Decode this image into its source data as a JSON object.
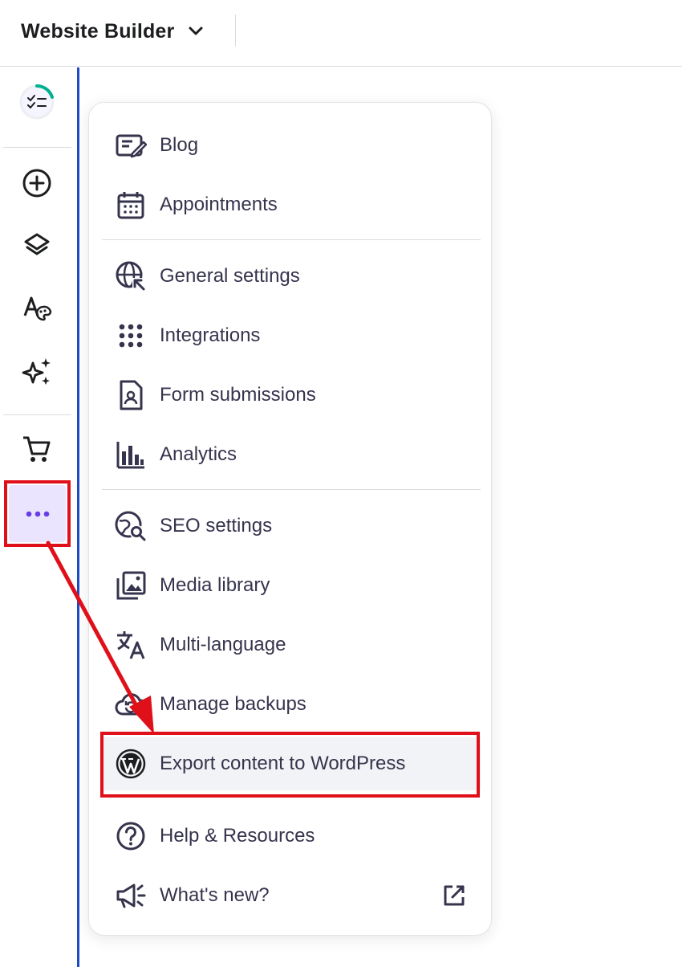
{
  "header": {
    "app_title": "Website Builder",
    "switcher_icon": "chevron-down-icon"
  },
  "sidebar": {
    "items": [
      {
        "icon": "checklist-progress-icon"
      },
      {
        "icon": "add-circle-icon"
      },
      {
        "icon": "layers-icon"
      },
      {
        "icon": "typography-palette-icon"
      },
      {
        "icon": "ai-sparkle-icon"
      },
      {
        "icon": "cart-icon"
      },
      {
        "icon": "more-dots-icon"
      }
    ],
    "accent_color": "#673de6",
    "progress_color": "#00b090"
  },
  "menu": {
    "items": [
      {
        "label": "Blog",
        "icon": "blog-edit-icon"
      },
      {
        "label": "Appointments",
        "icon": "calendar-icon"
      },
      {
        "label": "General settings",
        "icon": "globe-settings-icon"
      },
      {
        "label": "Integrations",
        "icon": "grid-dots-icon"
      },
      {
        "label": "Form submissions",
        "icon": "form-user-icon"
      },
      {
        "label": "Analytics",
        "icon": "bar-chart-icon"
      },
      {
        "label": "SEO settings",
        "icon": "globe-search-icon"
      },
      {
        "label": "Media library",
        "icon": "image-library-icon"
      },
      {
        "label": "Multi-language",
        "icon": "translate-icon"
      },
      {
        "label": "Manage backups",
        "icon": "cloud-backup-icon"
      },
      {
        "label": "Export content to WordPress",
        "icon": "wordpress-icon"
      },
      {
        "label": "Help & Resources",
        "icon": "help-circle-icon"
      },
      {
        "label": "What's new?",
        "icon": "megaphone-icon",
        "trailing_icon": "external-link-icon"
      }
    ]
  },
  "annotation": {
    "highlight_color": "#e0101a"
  }
}
